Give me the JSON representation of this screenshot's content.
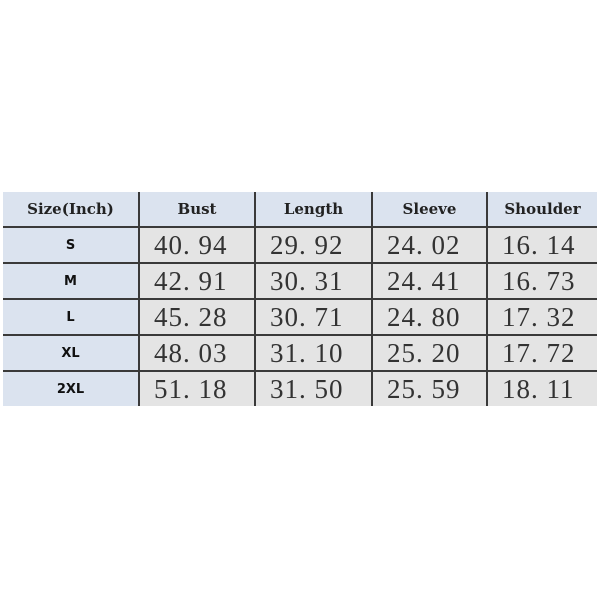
{
  "table": {
    "headers": [
      "Size(Inch)",
      "Bust",
      "Length",
      "Sleeve",
      "Shoulder"
    ],
    "rows": [
      [
        "S",
        "40. 94",
        "29. 92",
        "24. 02",
        "16. 14"
      ],
      [
        "M",
        "42. 91",
        "30. 31",
        "24. 41",
        "16. 73"
      ],
      [
        "L",
        "45. 28",
        "30. 71",
        "24. 80",
        "17. 32"
      ],
      [
        "XL",
        "48. 03",
        "31. 10",
        "25. 20",
        "17. 72"
      ],
      [
        "2XL",
        "51. 18",
        "31. 50",
        "25. 59",
        "18. 11"
      ]
    ]
  },
  "colors": {
    "header_bg": "#dbe3ef",
    "cell_bg": "#e4e4e4",
    "border": "#3a3a3a"
  }
}
